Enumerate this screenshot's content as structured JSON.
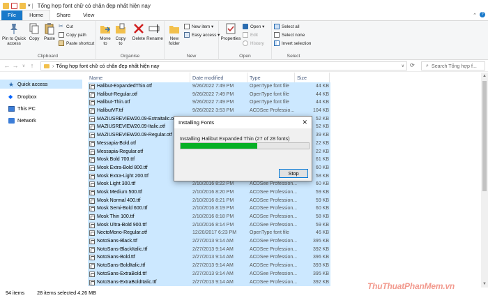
{
  "window": {
    "title": "Tổng hợp font chữ có chân đẹp nhất hiện nay"
  },
  "tabs": [
    {
      "label": "File"
    },
    {
      "label": "Home"
    },
    {
      "label": "Share"
    },
    {
      "label": "View"
    }
  ],
  "ribbon": {
    "clipboard": {
      "pin_label": "Pin to Quick access",
      "copy_label": "Copy",
      "paste_label": "Paste",
      "cut_label": "Cut",
      "copy_path_label": "Copy path",
      "paste_shortcut_label": "Paste shortcut",
      "group_label": "Clipboard"
    },
    "organise": {
      "move_to_label": "Move to",
      "copy_to_label": "Copy to",
      "delete_label": "Delete",
      "rename_label": "Rename",
      "group_label": "Organise"
    },
    "new": {
      "new_folder_label": "New folder",
      "new_item_label": "New item ▾",
      "easy_access_label": "Easy access ▾",
      "group_label": "New"
    },
    "open": {
      "properties_label": "Properties",
      "open_label": "Open ▾",
      "edit_label": "Edit",
      "history_label": "History",
      "group_label": "Open"
    },
    "select": {
      "select_all_label": "Select all",
      "select_none_label": "Select none",
      "invert_label": "Invert selection",
      "group_label": "Select"
    }
  },
  "address": {
    "path": "Tổng hợp font chữ có chân đẹp nhất hiện nay",
    "search_placeholder": "Search Tổng hợp f..."
  },
  "nav": {
    "items": [
      {
        "label": "Quick access"
      },
      {
        "label": "Dropbox"
      },
      {
        "label": "This PC"
      },
      {
        "label": "Network"
      }
    ]
  },
  "columns": {
    "name": "Name",
    "date": "Date modified",
    "type": "Type",
    "size": "Size"
  },
  "files": [
    {
      "name": "Halibut-ExpandedThin.otf",
      "date": "9/26/2022 7:49 PM",
      "type": "OpenType font file",
      "size": "44 KB"
    },
    {
      "name": "Halibut-Regular.otf",
      "date": "9/26/2022 7:49 PM",
      "type": "OpenType font file",
      "size": "44 KB"
    },
    {
      "name": "Halibut-Thin.otf",
      "date": "9/26/2022 7:49 PM",
      "type": "OpenType font file",
      "size": "44 KB"
    },
    {
      "name": "HalibutVF.ttf",
      "date": "9/26/2022 3:53 PM",
      "type": "ACDSee Professio...",
      "size": "104 KB"
    },
    {
      "name": "MAZIUSREVIEW20.09-Extraitalic.otf",
      "date": "",
      "type": "",
      "size": "52 KB"
    },
    {
      "name": "MAZIUSREVIEW20.09-Italic.otf",
      "date": "",
      "type": "",
      "size": "52 KB"
    },
    {
      "name": "MAZIUSREVIEW20.09-Regular.otf",
      "date": "",
      "type": "",
      "size": "39 KB"
    },
    {
      "name": "Messapia-Bold.otf",
      "date": "",
      "type": "",
      "size": "22 KB"
    },
    {
      "name": "Messapia-Regular.otf",
      "date": "",
      "type": "",
      "size": "22 KB"
    },
    {
      "name": "Mosk Bold 700.ttf",
      "date": "",
      "type": "",
      "size": "61 KB"
    },
    {
      "name": "Mosk Extra-Bold 800.ttf",
      "date": "",
      "type": "",
      "size": "60 KB"
    },
    {
      "name": "Mosk Extra-Light 200.ttf",
      "date": "",
      "type": "",
      "size": "58 KB"
    },
    {
      "name": "Mosk Light 300.ttf",
      "date": "2/10/2016 8:22 PM",
      "type": "ACDSee Profession...",
      "size": "60 KB"
    },
    {
      "name": "Mosk Medium 500.ttf",
      "date": "2/10/2016 8:20 PM",
      "type": "ACDSee Profession...",
      "size": "59 KB"
    },
    {
      "name": "Mosk Normal 400.ttf",
      "date": "2/10/2016 8:21 PM",
      "type": "ACDSee Profession...",
      "size": "59 KB"
    },
    {
      "name": "Mosk Semi-Bold 600.ttf",
      "date": "2/10/2016 8:19 PM",
      "type": "ACDSee Profession...",
      "size": "60 KB"
    },
    {
      "name": "Mosk Thin 100.ttf",
      "date": "2/10/2016 8:18 PM",
      "type": "ACDSee Profession...",
      "size": "58 KB"
    },
    {
      "name": "Mosk Ultra-Bold 900.ttf",
      "date": "2/10/2016 8:14 PM",
      "type": "ACDSee Profession...",
      "size": "59 KB"
    },
    {
      "name": "NectoMono-Regular.otf",
      "date": "12/20/2017 6:23 PM",
      "type": "OpenType font file",
      "size": "46 KB"
    },
    {
      "name": "NotoSans-Black.ttf",
      "date": "2/27/2013 9:14 AM",
      "type": "ACDSee Profession...",
      "size": "395 KB"
    },
    {
      "name": "NotoSans-BlackItalic.ttf",
      "date": "2/27/2013 9:14 AM",
      "type": "ACDSee Profession...",
      "size": "392 KB"
    },
    {
      "name": "NotoSans-Bold.ttf",
      "date": "2/27/2013 9:14 AM",
      "type": "ACDSee Profession...",
      "size": "396 KB"
    },
    {
      "name": "NotoSans-BoldItalic.ttf",
      "date": "2/27/2013 9:14 AM",
      "type": "ACDSee Profession...",
      "size": "393 KB"
    },
    {
      "name": "NotoSans-ExtraBold.ttf",
      "date": "2/27/2013 9:14 AM",
      "type": "ACDSee Profession...",
      "size": "395 KB"
    },
    {
      "name": "NotoSans-ExtraBoldItalic.ttf",
      "date": "2/27/2013 9:14 AM",
      "type": "ACDSee Profession...",
      "size": "392 KB"
    }
  ],
  "status": {
    "items_count": "94 items",
    "selection": "28 items selected  4.26 MB"
  },
  "dialog": {
    "title": "Installing Fonts",
    "message": "Installing Halibut Expanded Thin (27 of 28 fonts)",
    "progress_fraction": 0.6,
    "stop_label": "Stop",
    "close_glyph": "✕"
  },
  "watermark": {
    "text": "ThuThuatPhanMem.vn"
  },
  "colors": {
    "accent": "#1979ca",
    "selection": "#cce8ff",
    "progress": "#06b025"
  }
}
